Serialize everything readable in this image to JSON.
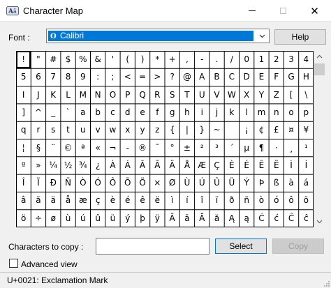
{
  "window": {
    "title": "Character Map",
    "close_glyph": "✕"
  },
  "font": {
    "label": "Font :",
    "selected": "Calibri",
    "type_badge": "O"
  },
  "help_label": "Help",
  "grid": {
    "columns": 18,
    "selected_index": 0,
    "rows": [
      [
        "!",
        "\"",
        "#",
        "$",
        "%",
        "&",
        "'",
        "(",
        ")",
        "*",
        "+",
        ",",
        "-",
        ".",
        "/",
        "0",
        "1",
        "2",
        "3",
        "4"
      ],
      [
        "5",
        "6",
        "7",
        "8",
        "9",
        ":",
        ";",
        "<",
        "=",
        ">",
        "?",
        "@",
        "A",
        "B",
        "C",
        "D",
        "E",
        "F",
        "G",
        "H"
      ],
      [
        "I",
        "J",
        "K",
        "L",
        "M",
        "N",
        "O",
        "P",
        "Q",
        "R",
        "S",
        "T",
        "U",
        "V",
        "W",
        "X",
        "Y",
        "Z",
        "[",
        "\\"
      ],
      [
        "]",
        "^",
        "_",
        "`",
        "a",
        "b",
        "c",
        "d",
        "e",
        "f",
        "g",
        "h",
        "i",
        "j",
        "k",
        "l",
        "m",
        "n",
        "o",
        "p"
      ],
      [
        "q",
        "r",
        "s",
        "t",
        "u",
        "v",
        "w",
        "x",
        "y",
        "z",
        "{",
        "|",
        "}",
        "~",
        " ",
        "¡",
        "¢",
        "£",
        "¤",
        "¥"
      ],
      [
        "¦",
        "§",
        "¨",
        "©",
        "ª",
        "«",
        "¬",
        "-",
        "®",
        "¯",
        "°",
        "±",
        "²",
        "³",
        "´",
        "µ",
        "¶",
        "·",
        "¸",
        "¹"
      ],
      [
        "º",
        "»",
        "¼",
        "½",
        "¾",
        "¿",
        "À",
        "Á",
        "Â",
        "Ã",
        "Ä",
        "Å",
        "Æ",
        "Ç",
        "È",
        "É",
        "Ê",
        "Ë",
        "Ì",
        "Í"
      ],
      [
        "Î",
        "Ï",
        "Ð",
        "Ñ",
        "Ò",
        "Ó",
        "Ô",
        "Õ",
        "Ö",
        "×",
        "Ø",
        "Ù",
        "Ú",
        "Û",
        "Ü",
        "Ý",
        "Þ",
        "ß",
        "à",
        "á"
      ],
      [
        "â",
        "ã",
        "ä",
        "å",
        "æ",
        "ç",
        "è",
        "é",
        "ê",
        "ë",
        "ì",
        "í",
        "î",
        "ï",
        "ð",
        "ñ",
        "ò",
        "ó",
        "ô",
        "õ"
      ],
      [
        "ö",
        "÷",
        "ø",
        "ù",
        "ú",
        "û",
        "ü",
        "ý",
        "þ",
        "ÿ",
        "Ā",
        "ā",
        "Ă",
        "ă",
        "Ą",
        "ą",
        "Ć",
        "ć",
        "Ĉ",
        "ĉ"
      ]
    ]
  },
  "copy": {
    "label": "Characters to copy :",
    "value": "",
    "select_label": "Select",
    "copy_label": "Copy"
  },
  "advanced": {
    "label": "Advanced view",
    "checked": false
  },
  "status": "U+0021: Exclamation Mark",
  "colors": {
    "accent": "#0078d7",
    "window_bg": "#f0f0f0"
  }
}
